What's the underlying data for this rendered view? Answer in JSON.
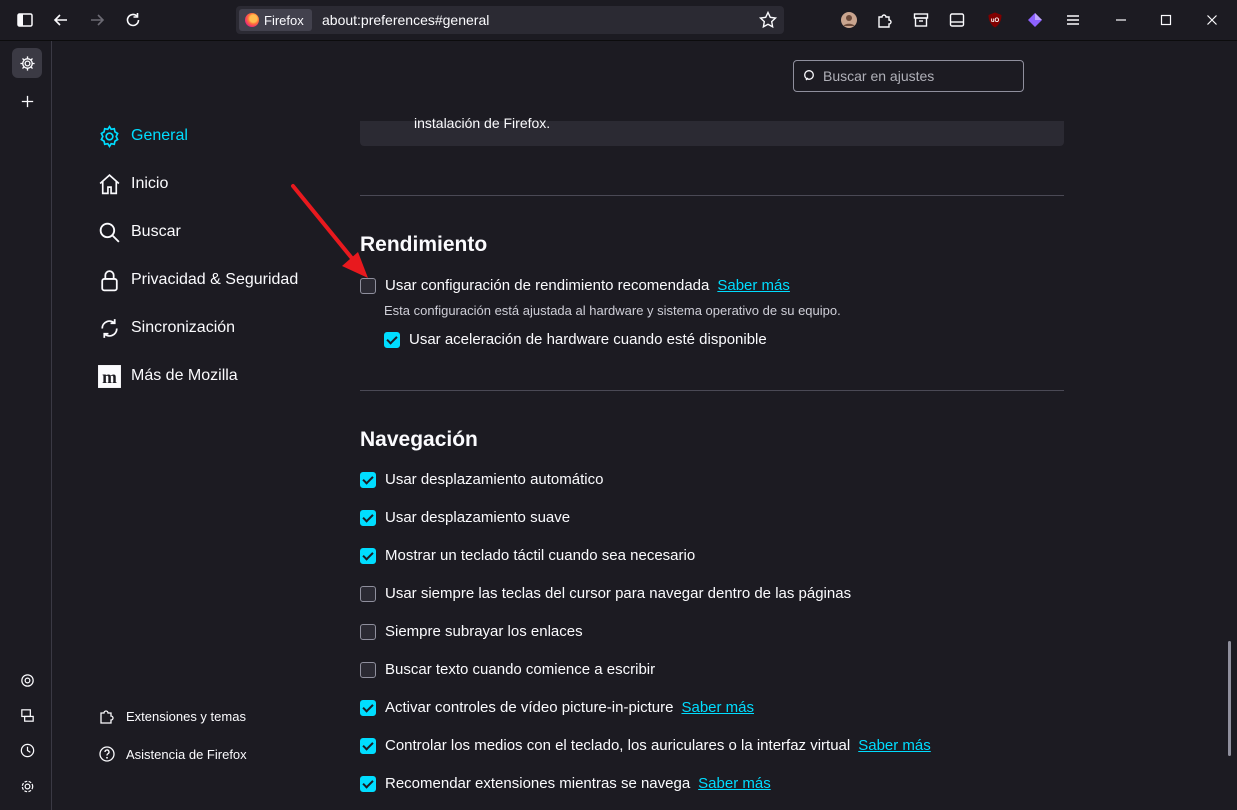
{
  "toolbar": {
    "identity_label": "Firefox",
    "url": "about:preferences#general"
  },
  "search": {
    "placeholder": "Buscar en ajustes"
  },
  "sidebar": {
    "items": [
      {
        "label": "General",
        "icon": "gear-icon",
        "active": true
      },
      {
        "label": "Inicio",
        "icon": "home-icon"
      },
      {
        "label": "Buscar",
        "icon": "search-icon"
      },
      {
        "label": "Privacidad & Seguridad",
        "icon": "lock-icon"
      },
      {
        "label": "Sincronización",
        "icon": "sync-icon"
      },
      {
        "label": "Más de Mozilla",
        "icon": "mozilla-icon"
      }
    ],
    "footer": [
      {
        "label": "Extensiones y temas",
        "icon": "puzzle-icon"
      },
      {
        "label": "Asistencia de Firefox",
        "icon": "help-icon"
      }
    ]
  },
  "top_panel_text": "instalación de Firefox.",
  "performance": {
    "title": "Rendimiento",
    "recommended": {
      "label": "Usar configuración de rendimiento recomendada",
      "checked": false,
      "link": "Saber más"
    },
    "description": "Esta configuración está ajustada al hardware y sistema operativo de su equipo.",
    "hw_accel": {
      "label": "Usar aceleración de hardware cuando esté disponible",
      "checked": true
    }
  },
  "navigation": {
    "title": "Navegación",
    "options": [
      {
        "label": "Usar desplazamiento automático",
        "checked": true,
        "link": ""
      },
      {
        "label": "Usar desplazamiento suave",
        "checked": true,
        "link": ""
      },
      {
        "label": "Mostrar un teclado táctil cuando sea necesario",
        "checked": true,
        "link": ""
      },
      {
        "label": "Usar siempre las teclas del cursor para navegar dentro de las páginas",
        "checked": false,
        "link": ""
      },
      {
        "label": "Siempre subrayar los enlaces",
        "checked": false,
        "link": ""
      },
      {
        "label": "Buscar texto cuando comience a escribir",
        "checked": false,
        "link": ""
      },
      {
        "label": "Activar controles de vídeo picture-in-picture",
        "checked": true,
        "link": "Saber más"
      },
      {
        "label": "Controlar los medios con el teclado, los auriculares o la interfaz virtual",
        "checked": true,
        "link": "Saber más"
      },
      {
        "label": "Recomendar extensiones mientras se navega",
        "checked": true,
        "link": "Saber más"
      }
    ]
  },
  "colors": {
    "accent": "#00ddff",
    "background": "#1c1b22",
    "annotation_arrow": "#e8191e"
  }
}
